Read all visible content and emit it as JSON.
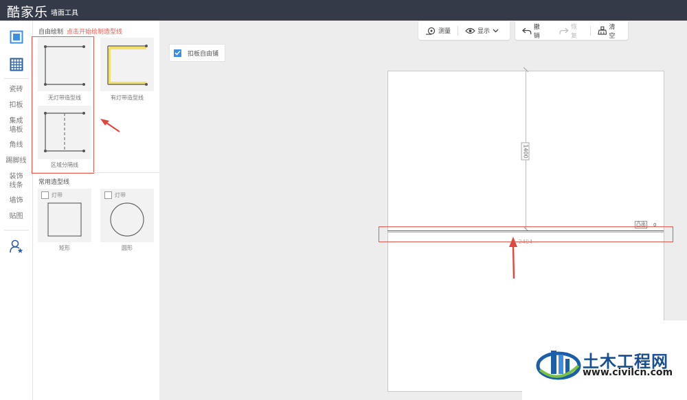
{
  "app": {
    "logo": "酷家乐",
    "module": "墙面工具"
  },
  "rail": {
    "items": [
      "瓷砖",
      "扣板",
      "集成",
      "墙板",
      "角线",
      "踢脚线",
      "装饰",
      "线条",
      "墙饰",
      "贴图"
    ]
  },
  "panel": {
    "free_draw": {
      "title": "自由绘制",
      "hint": "点击开始绘制造型线",
      "options": [
        "无灯带造型线",
        "有灯带造型线",
        "区域分隔线"
      ]
    },
    "common": {
      "title": "常用造型线",
      "light_strip_label": "灯带",
      "shapes": [
        "矩形",
        "圆形"
      ]
    }
  },
  "toolbar": {
    "measure": "测量",
    "display": "显示",
    "undo": "撤销",
    "redo": "恢复",
    "clear": "清空"
  },
  "free_tile": {
    "label": "扣板自由铺",
    "checked": true
  },
  "canvas": {
    "vertical_dim": "1400",
    "horizontal_dim": "2404",
    "extrude_label": "凸出",
    "extrude_value": "0"
  },
  "watermark": {
    "brand": "土木工程网",
    "url": "www.civilcn.com"
  },
  "colors": {
    "accent": "#3c8fe0",
    "topbar": "#343a48",
    "highlight": "#e05a52",
    "light_strip": "#f2e06a"
  }
}
